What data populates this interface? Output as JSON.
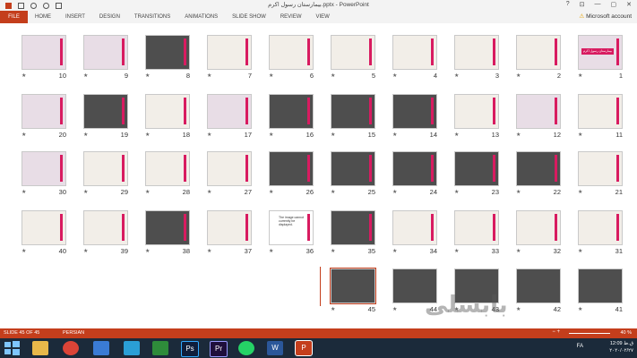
{
  "window": {
    "title": "بیمارستان رسول اکرم.pptx - PowerPoint",
    "controls": [
      "?",
      "⊡",
      "—",
      "▢",
      "✕"
    ]
  },
  "ribbon": {
    "file": "FILE",
    "tabs": [
      "HOME",
      "INSERT",
      "DESIGN",
      "TRANSITIONS",
      "ANIMATIONS",
      "SLIDE SHOW",
      "REVIEW",
      "VIEW"
    ],
    "account": "Microsoft account",
    "account_icon": "warning-icon"
  },
  "slides": [
    {
      "n": "1"
    },
    {
      "n": "2"
    },
    {
      "n": "3"
    },
    {
      "n": "4"
    },
    {
      "n": "5"
    },
    {
      "n": "6"
    },
    {
      "n": "7"
    },
    {
      "n": "8"
    },
    {
      "n": "9"
    },
    {
      "n": "10"
    },
    {
      "n": "11"
    },
    {
      "n": "12"
    },
    {
      "n": "13"
    },
    {
      "n": "14"
    },
    {
      "n": "15"
    },
    {
      "n": "16"
    },
    {
      "n": "17"
    },
    {
      "n": "18"
    },
    {
      "n": "19"
    },
    {
      "n": "20"
    },
    {
      "n": "21"
    },
    {
      "n": "22"
    },
    {
      "n": "23"
    },
    {
      "n": "24"
    },
    {
      "n": "25"
    },
    {
      "n": "26"
    },
    {
      "n": "27"
    },
    {
      "n": "28"
    },
    {
      "n": "29"
    },
    {
      "n": "30"
    },
    {
      "n": "31"
    },
    {
      "n": "32"
    },
    {
      "n": "33"
    },
    {
      "n": "34"
    },
    {
      "n": "35"
    },
    {
      "n": "36"
    },
    {
      "n": "37"
    },
    {
      "n": "38"
    },
    {
      "n": "39"
    },
    {
      "n": "40"
    },
    {
      "n": "41"
    },
    {
      "n": "42"
    },
    {
      "n": "43"
    },
    {
      "n": "44"
    },
    {
      "n": "45"
    }
  ],
  "slide1_text": "بیمارستان رسول اکرم",
  "slide36_text": "The image cannot currently be displayed.",
  "star": "★",
  "watermark": "بابسلی",
  "status": {
    "slide": "SLIDE 45 OF 45",
    "language": "PERSIAN",
    "zoom": "40 %",
    "zoom_controls": "−                 +"
  },
  "taskbar": {
    "apps": [
      "Ps",
      "Pr",
      "W",
      "P"
    ],
    "lang": "FA",
    "time": "12:09 ق.ظ",
    "date": "۲۰۲۰/۰۲/۲۷"
  },
  "colors": {
    "accent": "#c43e1c",
    "slide_bar": "#d81b60",
    "taskbar": "#1b2a3a"
  }
}
